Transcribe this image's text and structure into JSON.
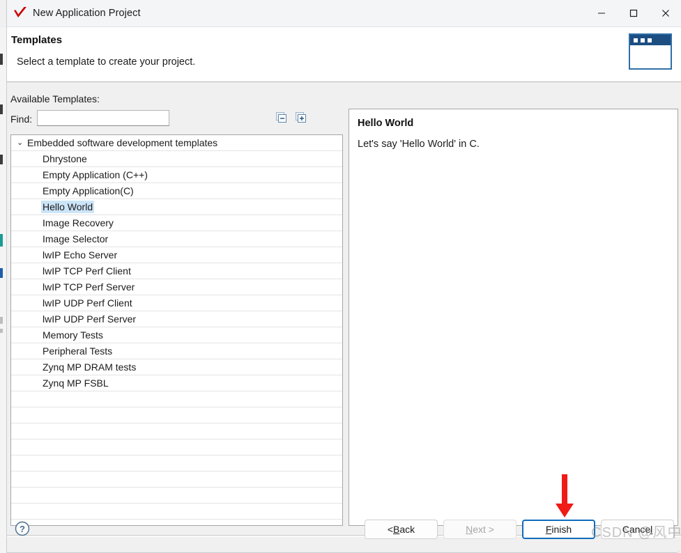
{
  "window": {
    "title": "New Application Project",
    "icon": "red-check-icon",
    "controls": {
      "minimize": "—",
      "maximize": "☐",
      "close": "✕"
    }
  },
  "banner": {
    "title": "Templates",
    "subtitle": "Select a template to create your project.",
    "art_icon": "dialog-window-icon"
  },
  "main": {
    "available_label": "Available Templates:",
    "find_label": "Find:",
    "find_value": "",
    "find_placeholder": "",
    "tools": [
      {
        "name": "collapse-all-icon",
        "title": "Collapse All"
      },
      {
        "name": "expand-all-icon",
        "title": "Expand All"
      }
    ],
    "tree": {
      "group_label": "Embedded software development templates",
      "group_expanded": true,
      "chevron": "⌄",
      "selected": "Hello World",
      "items": [
        "Dhrystone",
        "Empty Application (C++)",
        "Empty Application(C)",
        "Hello World",
        "Image Recovery",
        "Image Selector",
        "lwIP Echo Server",
        "lwIP TCP Perf Client",
        "lwIP TCP Perf Server",
        "lwIP UDP Perf Client",
        "lwIP UDP Perf Server",
        "Memory Tests",
        "Peripheral Tests",
        "Zynq MP DRAM tests",
        "Zynq MP FSBL"
      ],
      "empty_rows": 8
    },
    "description": {
      "title": "Hello World",
      "text": "Let's say 'Hello World' in C."
    }
  },
  "footer": {
    "help_icon": "help-question-icon",
    "buttons": [
      {
        "name": "back-button",
        "prefix": "< ",
        "mnemonic": "B",
        "suffix": "ack",
        "state": "normal"
      },
      {
        "name": "next-button",
        "prefix": "",
        "mnemonic": "N",
        "suffix": "ext >",
        "state": "disabled"
      },
      {
        "name": "finish-button",
        "prefix": "",
        "mnemonic": "F",
        "suffix": "inish",
        "state": "focused"
      },
      {
        "name": "cancel-button",
        "prefix": "Cance",
        "mnemonic": "l",
        "suffix": "",
        "state": "normal"
      }
    ]
  },
  "annotation": {
    "arrow_color": "#f01a16",
    "watermark": "CSDN @风中的小羊"
  },
  "colors": {
    "accent": "#0f6cbd",
    "selection": "#cce4f7",
    "banner_bg": "#ffffff",
    "body_bg": "#f0f0f0"
  }
}
